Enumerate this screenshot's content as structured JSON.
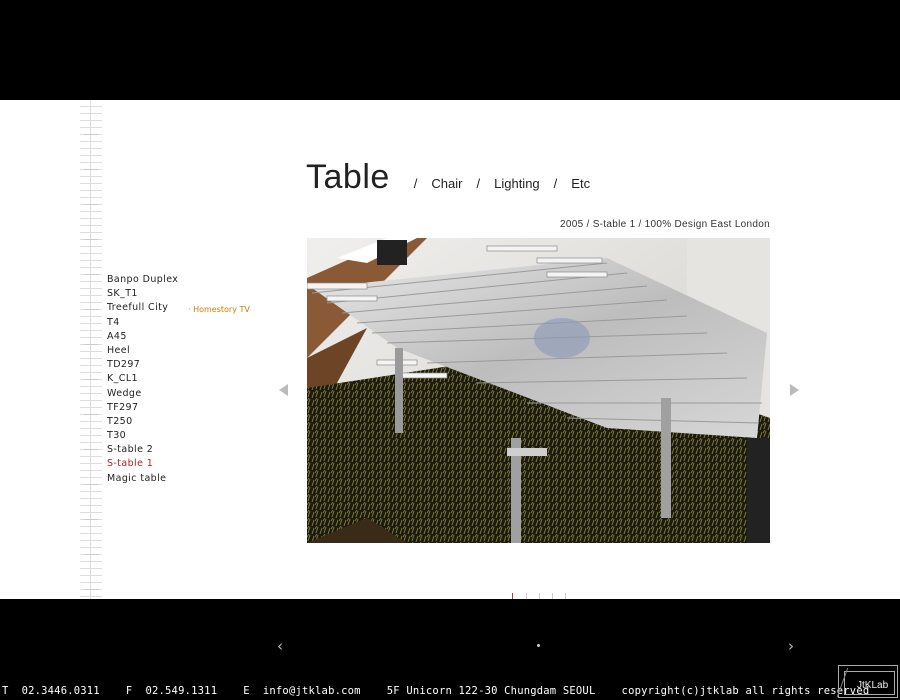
{
  "nav": {
    "title": "Table",
    "categories": [
      "Chair",
      "Lighting",
      "Etc"
    ],
    "separator": "/"
  },
  "caption": "2005 / S-table 1 / 100% Design East London",
  "projects": {
    "items": [
      "Banpo Duplex",
      "SK_T1",
      "Treefull City",
      "T4",
      "A45",
      "Heel",
      "TD297",
      "K_CL1",
      "Wedge",
      "TF297",
      "T250",
      "T30",
      "S-table 2",
      "S-table 1",
      "Magic table"
    ],
    "active": "S-table 1",
    "sub_item": "· Homestory TV"
  },
  "bottom_nav": {
    "prev": "‹",
    "next": "›"
  },
  "footer": {
    "text": "T  02.3446.0311    F  02.549.1311    E  info@jtklab.com    5F Unicorn 122-30 Chungdam SEOUL    copyright(c)jtklab all rights reserved"
  },
  "logo": "JtKLab",
  "colors": {
    "active": "#b22222",
    "sub_item": "#d57a00",
    "background": "#000000"
  }
}
